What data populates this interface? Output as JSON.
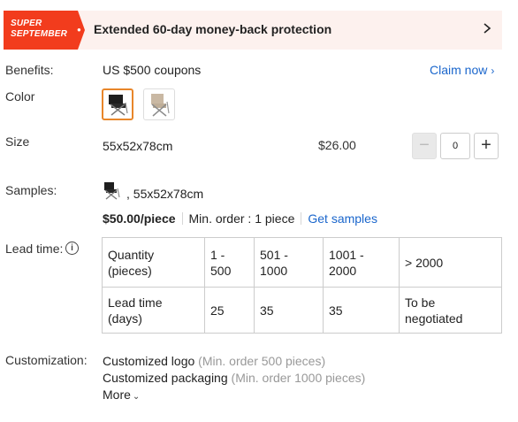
{
  "banner": {
    "badge_line1": "SUPER",
    "badge_line2": "SEPTEMBER",
    "text": "Extended 60-day money-back protection",
    "badge_color": "#f23c1d",
    "background_color": "#fdf1ee"
  },
  "benefits": {
    "label": "Benefits:",
    "value": "US $500 coupons",
    "link": "Claim now",
    "link_color": "#1a66cc"
  },
  "color": {
    "label": "Color",
    "options": [
      "black-folding-chair",
      "beige-folding-chair"
    ],
    "selected_index": 0,
    "selected_border_color": "#e8862a"
  },
  "size": {
    "label": "Size",
    "value": "55x52x78cm",
    "price": "$26.00",
    "quantity": "0",
    "minus": "−",
    "plus": "+"
  },
  "samples": {
    "label": "Samples:",
    "size": ", 55x52x78cm",
    "price": "$50.00/piece",
    "min_order": "Min. order : 1 piece",
    "link": "Get samples"
  },
  "lead_time": {
    "label": "Lead time:",
    "info_icon": "i",
    "headers": [
      "Quantity (pieces)",
      "1 - 500",
      "501 - 1000",
      "1001 - 2000",
      "> 2000"
    ],
    "row_label": "Lead time (days)",
    "values": [
      "25",
      "35",
      "35",
      "To be negotiated"
    ]
  },
  "customization": {
    "label": "Customization:",
    "items": [
      {
        "name": "Customized logo",
        "note": "(Min. order 500 pieces)"
      },
      {
        "name": "Customized packaging",
        "note": "(Min. order 1000 pieces)"
      }
    ],
    "more": "More"
  }
}
